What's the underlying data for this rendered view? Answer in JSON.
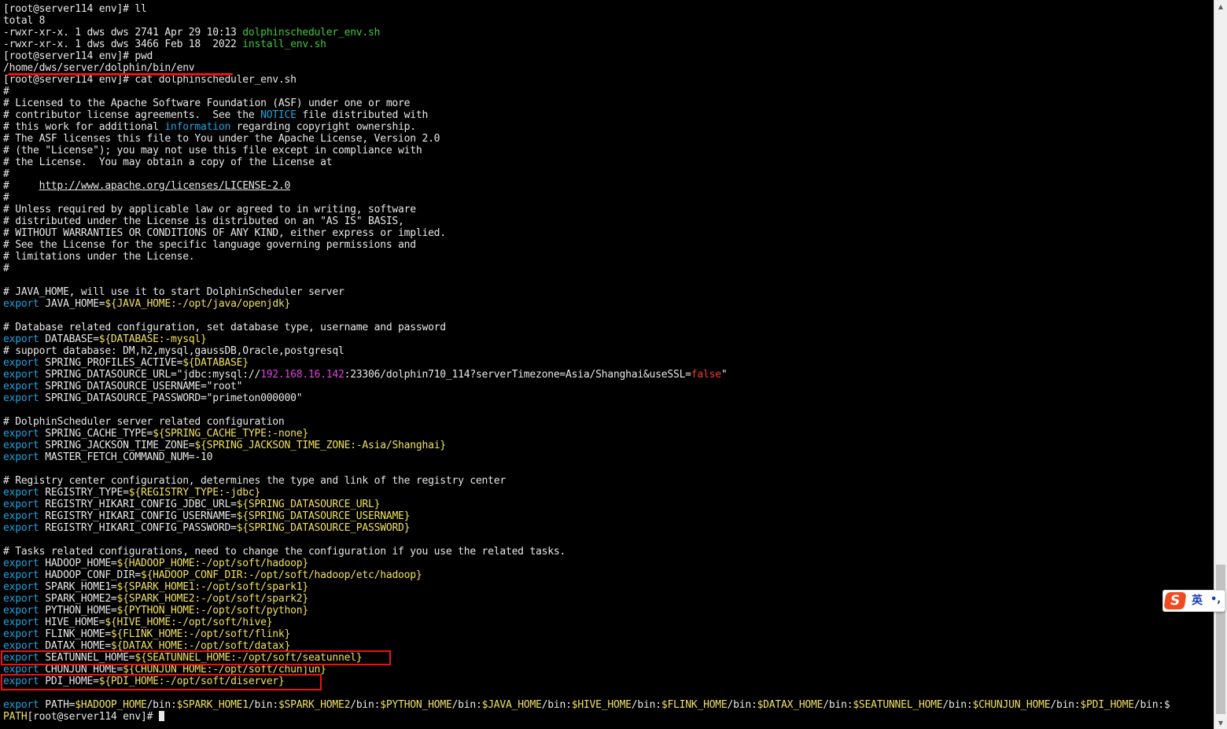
{
  "terminal": {
    "lines": [
      [
        [
          "[root@server114 env]# ll",
          "w"
        ]
      ],
      [
        [
          "total 8",
          "w"
        ]
      ],
      [
        [
          "-rwxr-xr-x. 1 dws dws 2741 Apr 29 10:13 ",
          "w"
        ],
        [
          "dolphinscheduler_env.sh",
          "g"
        ]
      ],
      [
        [
          "-rwxr-xr-x. 1 dws dws 3466 Feb 18  2022 ",
          "w"
        ],
        [
          "install_env.sh",
          "g"
        ]
      ],
      [
        [
          "[root@server114 env]# pwd",
          "w"
        ]
      ],
      [
        [
          "/home/dws/server/dolphin/bin/env",
          "w"
        ]
      ],
      [
        [
          "[root@server114 env]# cat dolphinscheduler_env.sh",
          "w"
        ]
      ],
      [
        [
          "#",
          "w"
        ]
      ],
      [
        [
          "# Licensed to the Apache Software Foundation (ASF) under one or more",
          "w"
        ]
      ],
      [
        [
          "# contributor license agreements.  See the ",
          "w"
        ],
        [
          "NOTICE",
          "c"
        ],
        [
          " file distributed with",
          "w"
        ]
      ],
      [
        [
          "# this work for additional ",
          "w"
        ],
        [
          "information",
          "c"
        ],
        [
          " regarding copyright ownership.",
          "w"
        ]
      ],
      [
        [
          "# The ASF licenses this file to You under the Apache License, Version 2.0",
          "w"
        ]
      ],
      [
        [
          "# (the \"License\"); you may not use this file except in compliance with",
          "w"
        ]
      ],
      [
        [
          "# the License.  You may obtain a copy of the License at",
          "w"
        ]
      ],
      [
        [
          "#",
          "w"
        ]
      ],
      [
        [
          "#     ",
          "w"
        ],
        [
          "http://www.apache.org/licenses/LICENSE-2.0",
          "wu"
        ]
      ],
      [
        [
          "#",
          "w"
        ]
      ],
      [
        [
          "# Unless required by applicable law or agreed to in writing, software",
          "w"
        ]
      ],
      [
        [
          "# distributed under the License is distributed on an \"AS IS\" BASIS,",
          "w"
        ]
      ],
      [
        [
          "# WITHOUT WARRANTIES OR CONDITIONS OF ANY KIND, either express or implied.",
          "w"
        ]
      ],
      [
        [
          "# See the License for the specific language governing permissions and",
          "w"
        ]
      ],
      [
        [
          "# limitations under the License.",
          "w"
        ]
      ],
      [
        [
          "#",
          "w"
        ]
      ],
      [
        [
          "",
          "w"
        ]
      ],
      [
        [
          "# JAVA_HOME, will use it to start DolphinScheduler server",
          "w"
        ]
      ],
      [
        [
          "export",
          "c"
        ],
        [
          " JAVA_HOME=",
          "w"
        ],
        [
          "${JAVA_HOME:-/opt/java/openjdk}",
          "y"
        ]
      ],
      [
        [
          "",
          "w"
        ]
      ],
      [
        [
          "# Database related configuration, set database type, username and password",
          "w"
        ]
      ],
      [
        [
          "export",
          "c"
        ],
        [
          " DATABASE=",
          "w"
        ],
        [
          "${DATABASE:-mysql}",
          "y"
        ]
      ],
      [
        [
          "# support database: DM,h2,mysql,gaussDB,Oracle,postgresql",
          "w"
        ]
      ],
      [
        [
          "export",
          "c"
        ],
        [
          " SPRING_PROFILES_ACTIVE=",
          "w"
        ],
        [
          "${DATABASE}",
          "y"
        ]
      ],
      [
        [
          "export",
          "c"
        ],
        [
          " SPRING_DATASOURCE_URL=\"jdbc:mysql://",
          "w"
        ],
        [
          "192.168.16.142",
          "m"
        ],
        [
          ":23306/dolphin710_114?serverTimezone=Asia/Shanghai&useSSL=",
          "w"
        ],
        [
          "false",
          "r"
        ],
        [
          "\"",
          "w"
        ]
      ],
      [
        [
          "export",
          "c"
        ],
        [
          " SPRING_DATASOURCE_USERNAME=\"root\"",
          "w"
        ]
      ],
      [
        [
          "export",
          "c"
        ],
        [
          " SPRING_DATASOURCE_PASSWORD=\"primeton000000\"",
          "w"
        ]
      ],
      [
        [
          "",
          "w"
        ]
      ],
      [
        [
          "# DolphinScheduler server related configuration",
          "w"
        ]
      ],
      [
        [
          "export",
          "c"
        ],
        [
          " SPRING_CACHE_TYPE=",
          "w"
        ],
        [
          "${SPRING_CACHE_TYPE:-none}",
          "y"
        ]
      ],
      [
        [
          "export",
          "c"
        ],
        [
          " SPRING_JACKSON_TIME_ZONE=",
          "w"
        ],
        [
          "${SPRING_JACKSON_TIME_ZONE:-Asia/Shanghai}",
          "y"
        ]
      ],
      [
        [
          "export",
          "c"
        ],
        [
          " MASTER_FETCH_COMMAND_NUM=-10",
          "w"
        ]
      ],
      [
        [
          "",
          "w"
        ]
      ],
      [
        [
          "# Registry center configuration, determines the type and link of the registry center",
          "w"
        ]
      ],
      [
        [
          "export",
          "c"
        ],
        [
          " REGISTRY_TYPE=",
          "w"
        ],
        [
          "${REGISTRY_TYPE:-jdbc}",
          "y"
        ]
      ],
      [
        [
          "export",
          "c"
        ],
        [
          " REGISTRY_HIKARI_CONFIG_JDBC_URL=",
          "w"
        ],
        [
          "${SPRING_DATASOURCE_URL}",
          "y"
        ]
      ],
      [
        [
          "export",
          "c"
        ],
        [
          " REGISTRY_HIKARI_CONFIG_USERNAME=",
          "w"
        ],
        [
          "${SPRING_DATASOURCE_USERNAME}",
          "y"
        ]
      ],
      [
        [
          "export",
          "c"
        ],
        [
          " REGISTRY_HIKARI_CONFIG_PASSWORD=",
          "w"
        ],
        [
          "${SPRING_DATASOURCE_PASSWORD}",
          "y"
        ]
      ],
      [
        [
          "",
          "w"
        ]
      ],
      [
        [
          "# Tasks related configurations, need to change the configuration if you use the related tasks.",
          "w"
        ]
      ],
      [
        [
          "export",
          "c"
        ],
        [
          " HADOOP_HOME=",
          "w"
        ],
        [
          "${HADOOP_HOME:-/opt/soft/hadoop}",
          "y"
        ]
      ],
      [
        [
          "export",
          "c"
        ],
        [
          " HADOOP_CONF_DIR=",
          "w"
        ],
        [
          "${HADOOP_CONF_DIR:-/opt/soft/hadoop/etc/hadoop}",
          "y"
        ]
      ],
      [
        [
          "export",
          "c"
        ],
        [
          " SPARK_HOME1=",
          "w"
        ],
        [
          "${SPARK_HOME1:-/opt/soft/spark1}",
          "y"
        ]
      ],
      [
        [
          "export",
          "c"
        ],
        [
          " SPARK_HOME2=",
          "w"
        ],
        [
          "${SPARK_HOME2:-/opt/soft/spark2}",
          "y"
        ]
      ],
      [
        [
          "export",
          "c"
        ],
        [
          " PYTHON_HOME=",
          "w"
        ],
        [
          "${PYTHON_HOME:-/opt/soft/python}",
          "y"
        ]
      ],
      [
        [
          "export",
          "c"
        ],
        [
          " HIVE_HOME=",
          "w"
        ],
        [
          "${HIVE_HOME:-/opt/soft/hive}",
          "y"
        ]
      ],
      [
        [
          "export",
          "c"
        ],
        [
          " FLINK_HOME=",
          "w"
        ],
        [
          "${FLINK_HOME:-/opt/soft/flink}",
          "y"
        ]
      ],
      [
        [
          "export",
          "c"
        ],
        [
          " DATAX_HOME=",
          "w"
        ],
        [
          "${DATAX_HOME:-/opt/soft/datax}",
          "y"
        ]
      ],
      [
        [
          "export",
          "c"
        ],
        [
          " SEATUNNEL_HOME=",
          "w"
        ],
        [
          "${SEATUNNEL_HOME:-/opt/soft/seatunnel}",
          "y"
        ]
      ],
      [
        [
          "export",
          "c"
        ],
        [
          " CHUNJUN_HOME=",
          "w"
        ],
        [
          "${CHUNJUN_HOME:-/opt/soft/chunjun}",
          "y"
        ]
      ],
      [
        [
          "export",
          "c"
        ],
        [
          " PDI_HOME=",
          "w"
        ],
        [
          "${PDI_HOME:-/opt/soft/diserver}",
          "y"
        ]
      ],
      [
        [
          "",
          "w"
        ]
      ],
      [
        [
          "export",
          "c"
        ],
        [
          " PATH=",
          "w"
        ],
        [
          "$HADOOP_HOME",
          "y"
        ],
        [
          "/bin:",
          "w"
        ],
        [
          "$SPARK_HOME1",
          "y"
        ],
        [
          "/bin:",
          "w"
        ],
        [
          "$SPARK_HOME2",
          "y"
        ],
        [
          "/bin:",
          "w"
        ],
        [
          "$PYTHON_HOME",
          "y"
        ],
        [
          "/bin:",
          "w"
        ],
        [
          "$JAVA_HOME",
          "y"
        ],
        [
          "/bin:",
          "w"
        ],
        [
          "$HIVE_HOME",
          "y"
        ],
        [
          "/bin:",
          "w"
        ],
        [
          "$FLINK_HOME",
          "y"
        ],
        [
          "/bin:",
          "w"
        ],
        [
          "$DATAX_HOME",
          "y"
        ],
        [
          "/bin:",
          "w"
        ],
        [
          "$SEATUNNEL_HOME",
          "y"
        ],
        [
          "/bin:",
          "w"
        ],
        [
          "$CHUNJUN_HOME",
          "y"
        ],
        [
          "/bin:",
          "w"
        ],
        [
          "$PDI_HOME",
          "y"
        ],
        [
          "/bin:$",
          "w"
        ]
      ],
      [
        [
          "PATH",
          "y"
        ],
        [
          "[root@server114 env]# ",
          "w"
        ]
      ]
    ]
  },
  "colors": {
    "background": "#000000",
    "text": "#e8e8e8",
    "green": "#3ec83e",
    "cyan": "#21a4e0",
    "yellow": "#f0e060",
    "magenta": "#e040e0",
    "red": "#f03a3a",
    "annotation": "#ee1111"
  },
  "scrollbar": {
    "up_arrow": "▲",
    "down_arrow": "▼"
  },
  "ime": {
    "logo": "S",
    "language": "英",
    "punctuation": "•,"
  }
}
